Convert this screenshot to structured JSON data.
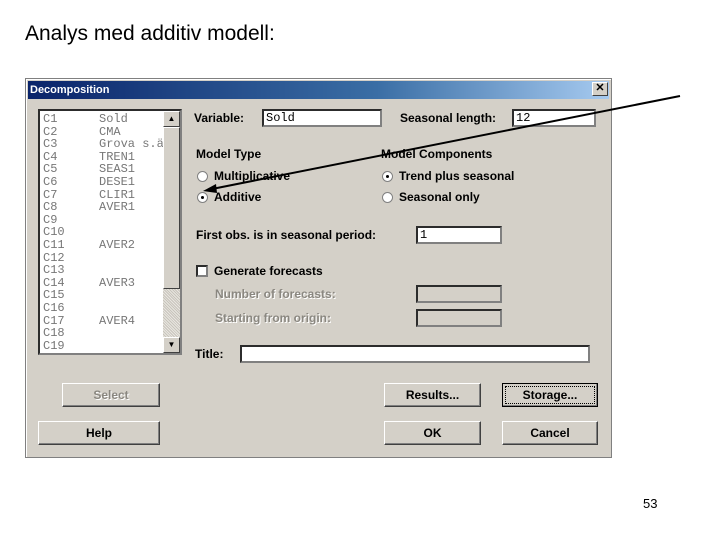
{
  "slide": {
    "title": "Analys med additiv modell:",
    "page_number": "53"
  },
  "dialog": {
    "title": "Decomposition",
    "close_label": "✕",
    "columns": [
      {
        "id": "C1",
        "name": "Sold"
      },
      {
        "id": "C2",
        "name": "CMA"
      },
      {
        "id": "C3",
        "name": "Grova s.ä"
      },
      {
        "id": "C4",
        "name": "TREN1"
      },
      {
        "id": "C5",
        "name": "SEAS1"
      },
      {
        "id": "C6",
        "name": "DESE1"
      },
      {
        "id": "C7",
        "name": "CLIR1"
      },
      {
        "id": "C8",
        "name": "AVER1"
      },
      {
        "id": "C9",
        "name": ""
      },
      {
        "id": "C10",
        "name": ""
      },
      {
        "id": "C11",
        "name": "AVER2"
      },
      {
        "id": "C12",
        "name": ""
      },
      {
        "id": "C13",
        "name": ""
      },
      {
        "id": "C14",
        "name": "AVER3"
      },
      {
        "id": "C15",
        "name": ""
      },
      {
        "id": "C16",
        "name": ""
      },
      {
        "id": "C17",
        "name": "AVER4"
      },
      {
        "id": "C18",
        "name": ""
      },
      {
        "id": "C19",
        "name": ""
      }
    ],
    "variable_label": "Variable:",
    "variable_value": "Sold",
    "seasonal_length_label": "Seasonal length:",
    "seasonal_length_value": "12",
    "model_type_label": "Model Type",
    "multiplicative_label": "Multiplicative",
    "additive_label": "Additive",
    "model_type_selected": "Additive",
    "model_components_label": "Model Components",
    "trend_label": "Trend plus seasonal",
    "seasonal_only_label": "Seasonal only",
    "model_components_selected": "Trend plus seasonal",
    "first_obs_label": "First obs. is in seasonal period:",
    "first_obs_value": "1",
    "generate_forecasts_label": "Generate forecasts",
    "generate_forecasts_checked": false,
    "num_forecasts_label": "Number of forecasts:",
    "num_forecasts_value": "",
    "origin_label": "Starting from origin:",
    "origin_value": "",
    "title_label": "Title:",
    "title_value": "",
    "buttons": {
      "select": "Select",
      "results": "Results...",
      "storage": "Storage...",
      "help": "Help",
      "ok": "OK",
      "cancel": "Cancel"
    }
  }
}
